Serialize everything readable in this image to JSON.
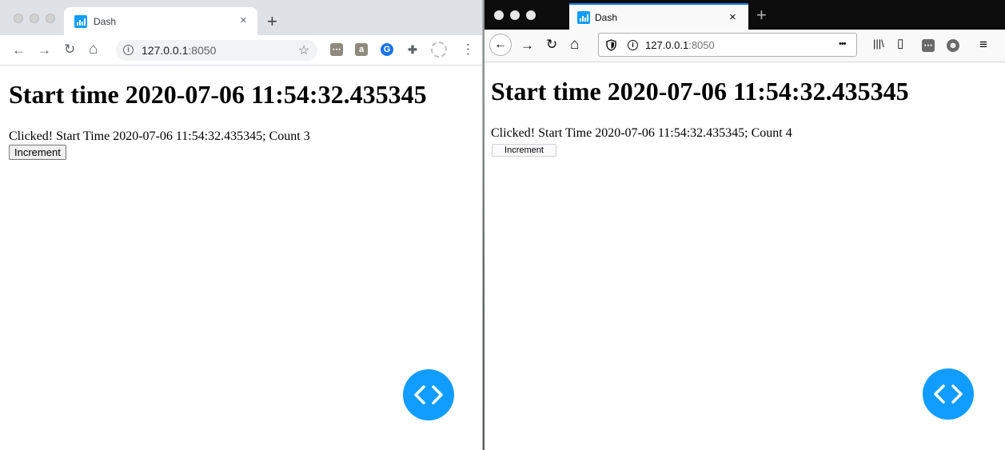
{
  "chrome": {
    "tab": {
      "title": "Dash",
      "close": "×"
    },
    "new_tab": "+",
    "toolbar": {
      "back": "←",
      "forward": "→",
      "reload": "↻",
      "home": "⌂",
      "star": "☆",
      "menu": "⋮"
    },
    "address": {
      "host": "127.0.0.1",
      "port": ":8050"
    },
    "extensions": [
      {
        "name": "extension-dots-icon",
        "glyph": "⋯",
        "color": "#8e8a7c"
      },
      {
        "name": "extension-a-icon",
        "glyph": "a",
        "color": "#8e8a7c"
      },
      {
        "name": "extension-g-icon",
        "glyph": "G",
        "color": "#1a73e8"
      },
      {
        "name": "puzzle-icon",
        "glyph": "✚",
        "color": "#5f6368"
      }
    ],
    "page": {
      "heading": "Start time 2020-07-06 11:54:32.435345",
      "status": "Clicked! Start Time 2020-07-06 11:54:32.435345; Count 3",
      "button": "Increment"
    }
  },
  "firefox": {
    "tab": {
      "title": "Dash",
      "close": "×"
    },
    "new_tab": "+",
    "toolbar": {
      "back": "←",
      "forward": "→",
      "reload": "↻",
      "home": "⌂",
      "more": "•••",
      "library": "|||\\",
      "sidebar": "▯",
      "menu": "≡"
    },
    "address": {
      "host": "127.0.0.1",
      "port": ":8050"
    },
    "page": {
      "heading": "Start time 2020-07-06 11:54:32.435345",
      "status": "Clicked! Start Time 2020-07-06 11:54:32.435345; Count 4",
      "button": "Increment"
    }
  },
  "colors": {
    "dash_blue": "#119dff",
    "firefox_tab_accent": "#0a84ff"
  }
}
